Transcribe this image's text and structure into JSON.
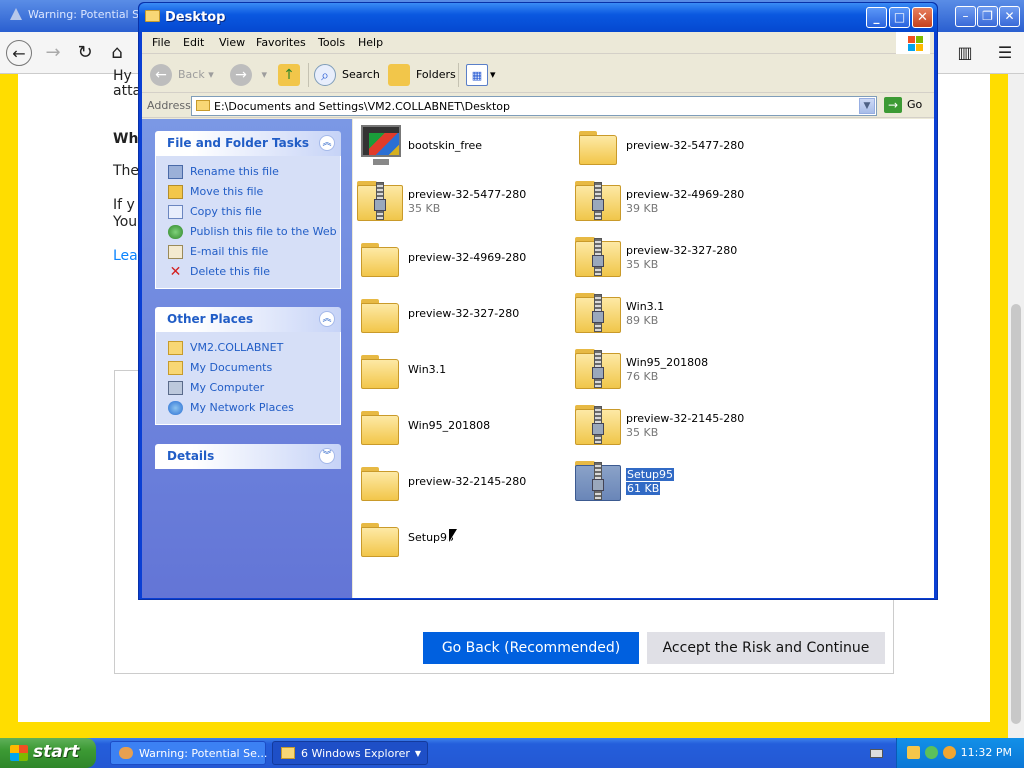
{
  "browser": {
    "title": "Warning: Potential Se",
    "page": {
      "frag1": "Hy",
      "frag2": "atta",
      "frag3": "Wh",
      "frag4": "The",
      "frag5": "If y",
      "frag6": "You",
      "frag7": "Lear"
    },
    "go_back": "Go Back (Recommended)",
    "accept": "Accept the Risk and Continue"
  },
  "explorer": {
    "title": "Desktop",
    "menu": [
      "File",
      "Edit",
      "View",
      "Favorites",
      "Tools",
      "Help"
    ],
    "toolbar": {
      "back": "Back",
      "search": "Search",
      "folders": "Folders"
    },
    "address": {
      "label": "Address",
      "value": "E:\\Documents and Settings\\VM2.COLLABNET\\Desktop",
      "go": "Go"
    },
    "panels": {
      "file_tasks": {
        "title": "File and Folder Tasks",
        "items": [
          "Rename this file",
          "Move this file",
          "Copy this file",
          "Publish this file to the Web",
          "E-mail this file",
          "Delete this file"
        ]
      },
      "other_places": {
        "title": "Other Places",
        "items": [
          "VM2.COLLABNET",
          "My Documents",
          "My Computer",
          "My Network Places"
        ]
      },
      "details": {
        "title": "Details"
      }
    },
    "files": [
      {
        "name": "bootskin_free",
        "size": "",
        "kind": "app"
      },
      {
        "name": "preview-32-5477-280",
        "size": "",
        "kind": "folder"
      },
      {
        "name": "preview-32-5477-280",
        "size": "35 KB",
        "kind": "zip"
      },
      {
        "name": "preview-32-4969-280",
        "size": "39 KB",
        "kind": "zip"
      },
      {
        "name": "preview-32-4969-280",
        "size": "",
        "kind": "folder"
      },
      {
        "name": "preview-32-327-280",
        "size": "35 KB",
        "kind": "zip"
      },
      {
        "name": "preview-32-327-280",
        "size": "",
        "kind": "folder"
      },
      {
        "name": "Win3.1",
        "size": "89 KB",
        "kind": "zip"
      },
      {
        "name": "Win3.1",
        "size": "",
        "kind": "folder"
      },
      {
        "name": "Win95_201808",
        "size": "76 KB",
        "kind": "zip"
      },
      {
        "name": "Win95_201808",
        "size": "",
        "kind": "folder"
      },
      {
        "name": "preview-32-2145-280",
        "size": "35 KB",
        "kind": "zip"
      },
      {
        "name": "preview-32-2145-280",
        "size": "",
        "kind": "folder"
      },
      {
        "name": "Setup95",
        "size": "61 KB",
        "kind": "zip",
        "selected": true
      },
      {
        "name": "Setup95",
        "size": "",
        "kind": "folder"
      }
    ]
  },
  "taskbar": {
    "start": "start",
    "buttons": [
      "Warning: Potential Se...",
      "6 Windows Explorer"
    ],
    "clock": "11:32 PM"
  }
}
